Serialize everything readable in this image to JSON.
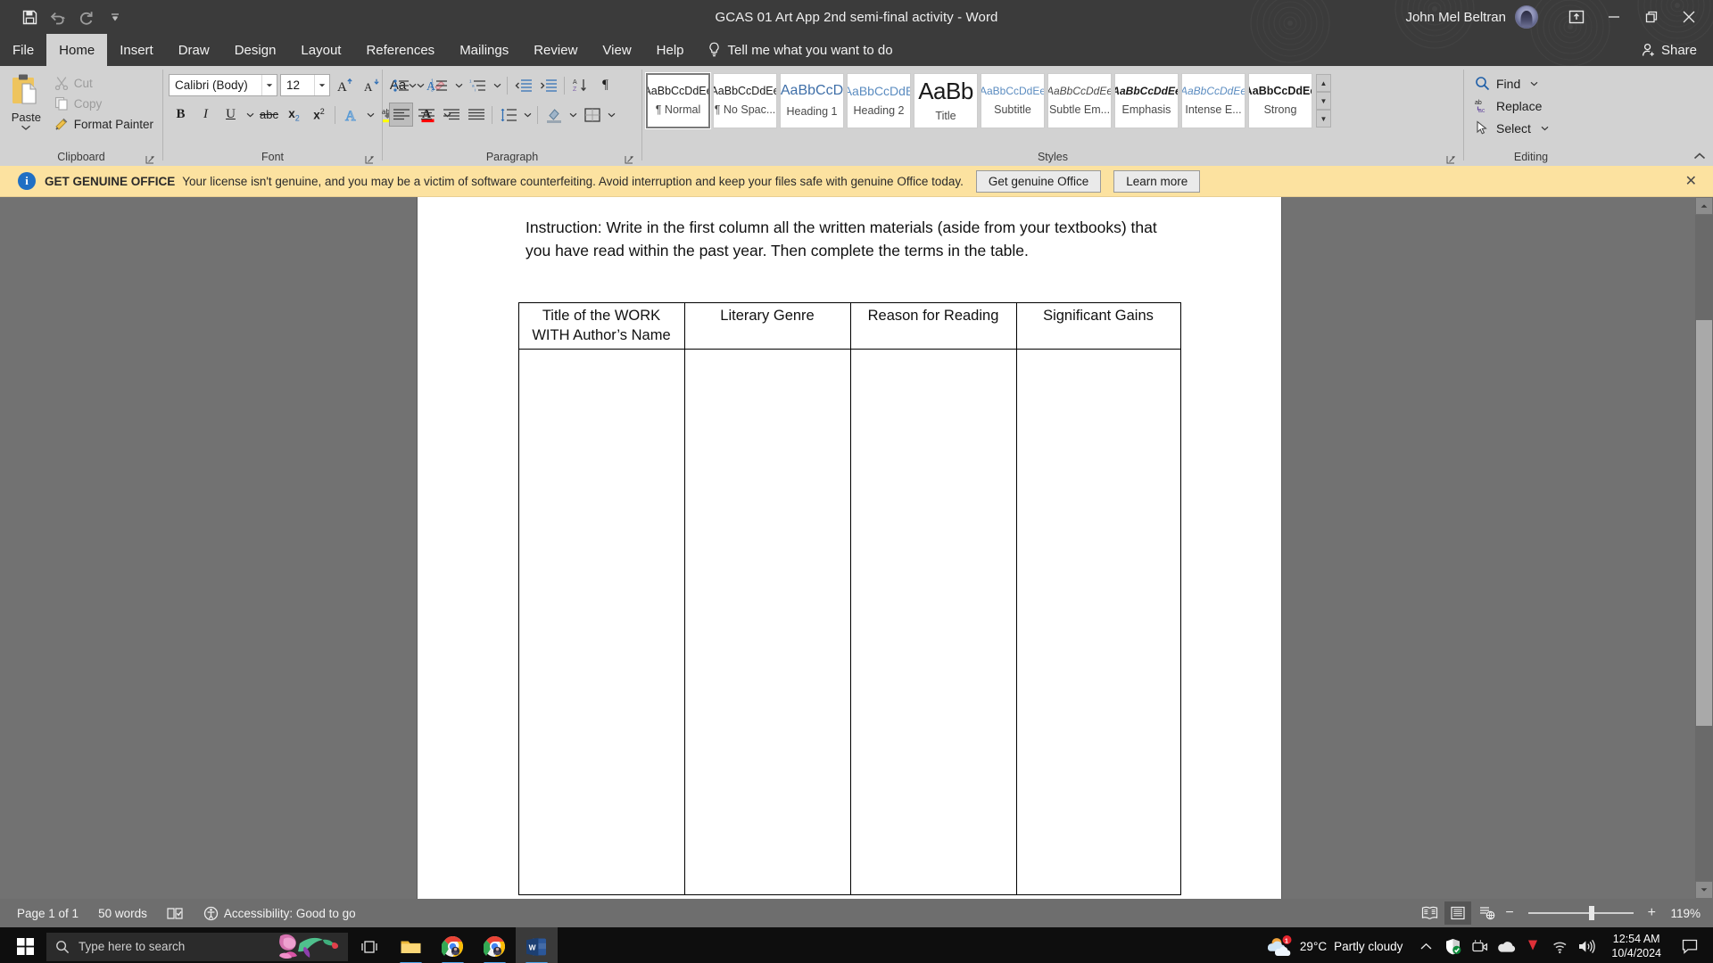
{
  "titlebar": {
    "quick_access": [
      {
        "name": "save-icon",
        "tooltip": "Save"
      },
      {
        "name": "undo-icon",
        "tooltip": "Undo"
      },
      {
        "name": "redo-icon",
        "tooltip": "Redo"
      },
      {
        "name": "customize-quick-access-toolbar-icon",
        "tooltip": "Customize Quick Access Toolbar"
      }
    ],
    "document_title": "GCAS 01 Art App 2nd semi-final activity",
    "app_separator": "-",
    "app_name": "Word",
    "user_name": "John Mel Beltran",
    "ribbon_display_options": "ribbon-display-options-icon",
    "minimize": "minimize-icon",
    "restore": "restore-icon",
    "close": "close-icon"
  },
  "tabs": [
    {
      "label": "File",
      "active": false
    },
    {
      "label": "Home",
      "active": true
    },
    {
      "label": "Insert",
      "active": false
    },
    {
      "label": "Draw",
      "active": false
    },
    {
      "label": "Design",
      "active": false
    },
    {
      "label": "Layout",
      "active": false
    },
    {
      "label": "References",
      "active": false
    },
    {
      "label": "Mailings",
      "active": false
    },
    {
      "label": "Review",
      "active": false
    },
    {
      "label": "View",
      "active": false
    },
    {
      "label": "Help",
      "active": false
    }
  ],
  "tell_me": "Tell me what you want to do",
  "share_label": "Share",
  "ribbon": {
    "clipboard": {
      "group_label": "Clipboard",
      "paste_label": "Paste",
      "cut_label": "Cut",
      "copy_label": "Copy",
      "format_painter_label": "Format Painter"
    },
    "font": {
      "group_label": "Font",
      "font_name": "Calibri (Body)",
      "font_size": "12",
      "buttons": [
        "grow-font-icon",
        "shrink-font-icon",
        "change-case-icon",
        "clear-formatting-icon",
        "bold-icon",
        "italic-icon",
        "underline-icon",
        "strikethrough-icon",
        "subscript-icon",
        "superscript-icon",
        "text-effects-icon",
        "text-highlight-color-icon",
        "font-color-icon"
      ]
    },
    "paragraph": {
      "group_label": "Paragraph",
      "buttons": [
        "bullets-icon",
        "numbering-icon",
        "multilevel-list-icon",
        "decrease-indent-icon",
        "increase-indent-icon",
        "sort-icon",
        "show-formatting-marks-icon",
        "align-left-icon",
        "align-center-icon",
        "align-right-icon",
        "justify-icon",
        "line-spacing-icon",
        "shading-icon",
        "borders-icon"
      ]
    },
    "styles": {
      "group_label": "Styles",
      "items": [
        {
          "preview": "AaBbCcDdEe",
          "name": "¶ Normal",
          "kind": "normal",
          "selected": true
        },
        {
          "preview": "AaBbCcDdEe",
          "name": "¶ No Spac...",
          "kind": "normal",
          "selected": false
        },
        {
          "preview": "AaBbCcD",
          "name": "Heading 1",
          "kind": "heading1",
          "selected": false
        },
        {
          "preview": "AaBbCcDdE",
          "name": "Heading 2",
          "kind": "heading2",
          "selected": false
        },
        {
          "preview": "AaBb",
          "name": "Title",
          "kind": "title",
          "selected": false
        },
        {
          "preview": "AaBbCcDdEe",
          "name": "Subtitle",
          "kind": "subtitle",
          "selected": false
        },
        {
          "preview": "AaBbCcDdEe",
          "name": "Subtle Em...",
          "kind": "subtle-emphasis",
          "selected": false
        },
        {
          "preview": "AaBbCcDdEe",
          "name": "Emphasis",
          "kind": "emphasis",
          "selected": false
        },
        {
          "preview": "AaBbCcDdEe",
          "name": "Intense E...",
          "kind": "intense-emphasis",
          "selected": false
        },
        {
          "preview": "AaBbCcDdEe",
          "name": "Strong",
          "kind": "strong",
          "selected": false
        }
      ]
    },
    "editing": {
      "group_label": "Editing",
      "find_label": "Find",
      "replace_label": "Replace",
      "select_label": "Select"
    }
  },
  "banner": {
    "title": "GET GENUINE OFFICE",
    "message": "Your license isn't genuine, and you may be a victim of software counterfeiting. Avoid interruption and keep your files safe with genuine Office today.",
    "primary_button": "Get genuine Office",
    "secondary_button": "Learn more",
    "close": "banner-close-icon",
    "background_color": "#fce2a0"
  },
  "document": {
    "instruction": "Instruction: Write in the first column all the written materials (aside from your textbooks) that you have read within the past year. Then complete the terms in the table.",
    "table": {
      "headers": [
        "Title of the WORK WITH Author’s Name",
        "Literary Genre",
        "Reason for Reading",
        "Significant Gains"
      ],
      "rows": [
        [
          "",
          "",
          "",
          ""
        ]
      ]
    }
  },
  "status_bar": {
    "page": "Page 1 of 1",
    "words": "50 words",
    "proofing_icon": "proofing-errors-icon",
    "accessibility": "Accessibility: Good to go",
    "views": [
      {
        "name": "read-mode-icon",
        "active": false
      },
      {
        "name": "print-layout-icon",
        "active": true
      },
      {
        "name": "web-layout-icon",
        "active": false
      }
    ],
    "zoom_out": "−",
    "zoom_in": "+",
    "zoom_level": "119%"
  },
  "taskbar": {
    "start": "windows-start-icon",
    "search_placeholder": "Type here to search",
    "task_view": "task-view-icon",
    "apps": [
      {
        "name": "file-explorer-icon",
        "active": false,
        "running": true
      },
      {
        "name": "chrome-icon",
        "active": false,
        "running": true
      },
      {
        "name": "chrome-icon",
        "active": false,
        "running": true
      },
      {
        "name": "word-icon",
        "active": true,
        "running": true
      }
    ],
    "weather_temp": "29°C",
    "weather_text": "Partly cloudy",
    "tray": [
      "show-hidden-icons-chevron",
      "windows-security-icon",
      "camera-icon",
      "onedrive-icon",
      "download-icon",
      "network-icon",
      "volume-icon"
    ],
    "time": "12:54 AM",
    "date": "10/4/2024",
    "action_center": "action-center-icon"
  },
  "colors": {
    "titlebar": "#3b3b3b",
    "ribbon": "#d2d2d2",
    "workspace": "#727272",
    "banner": "#fce2a0",
    "accent_blue": "#1f6fc4",
    "taskbar": "#0e0e0e"
  }
}
